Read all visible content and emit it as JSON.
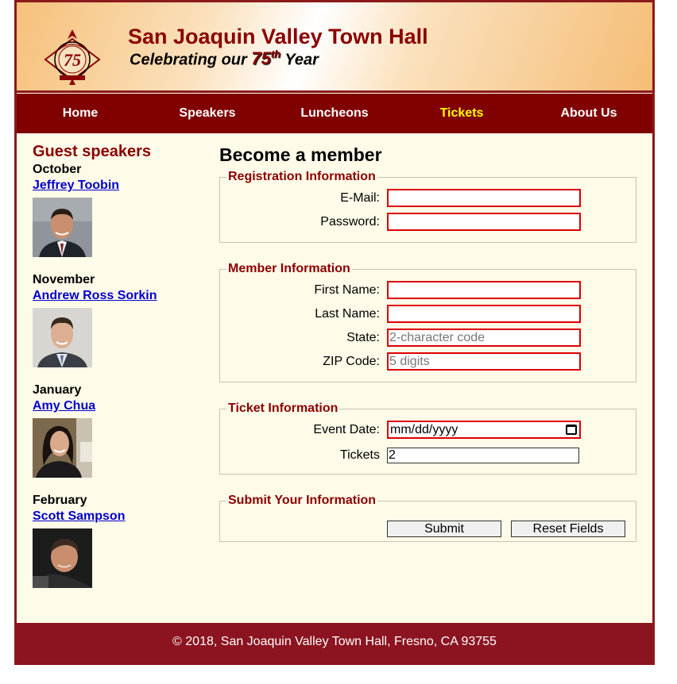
{
  "header": {
    "title": "San Joaquin Valley Town Hall",
    "tagline_prefix": "Celebrating our ",
    "tagline_number": "75",
    "tagline_ordinal": "th",
    "tagline_suffix": " Year",
    "logo_text": "75"
  },
  "nav": {
    "items": [
      {
        "label": "Home",
        "current": false
      },
      {
        "label": "Speakers",
        "current": false
      },
      {
        "label": "Luncheons",
        "current": false
      },
      {
        "label": "Tickets",
        "current": true
      },
      {
        "label": "About Us",
        "current": false
      }
    ]
  },
  "sidebar": {
    "heading": "Guest speakers",
    "speakers": [
      {
        "month": "October",
        "name": "Jeffrey Toobin"
      },
      {
        "month": "November",
        "name": "Andrew Ross Sorkin"
      },
      {
        "month": "January",
        "name": "Amy Chua"
      },
      {
        "month": "February",
        "name": "Scott Sampson"
      }
    ]
  },
  "main": {
    "heading": "Become a member",
    "registration": {
      "legend": "Registration Information",
      "email_label": "E-Mail:",
      "email_value": "",
      "password_label": "Password:",
      "password_value": ""
    },
    "member": {
      "legend": "Member Information",
      "first_name_label": "First Name:",
      "first_name_value": "",
      "last_name_label": "Last Name:",
      "last_name_value": "",
      "state_label": "State:",
      "state_placeholder": "2-character code",
      "zip_label": "ZIP Code:",
      "zip_placeholder": "5 digits"
    },
    "ticket": {
      "legend": "Ticket Information",
      "event_date_label": "Event Date:",
      "event_date_value": "mm/dd/yyyy",
      "tickets_label": "Tickets",
      "tickets_value": "2"
    },
    "submit": {
      "legend": "Submit Your Information",
      "submit_label": "Submit",
      "reset_label": "Reset Fields"
    }
  },
  "footer": {
    "text": "© 2018, San Joaquin Valley Town Hall, Fresno, CA 93755"
  },
  "colors": {
    "brand_red": "#8b0000",
    "nav_bg": "#800000",
    "nav_current": "#ffff00",
    "page_bg": "#fffbe9",
    "invalid_border": "#dd0000",
    "link": "#0000cc"
  }
}
